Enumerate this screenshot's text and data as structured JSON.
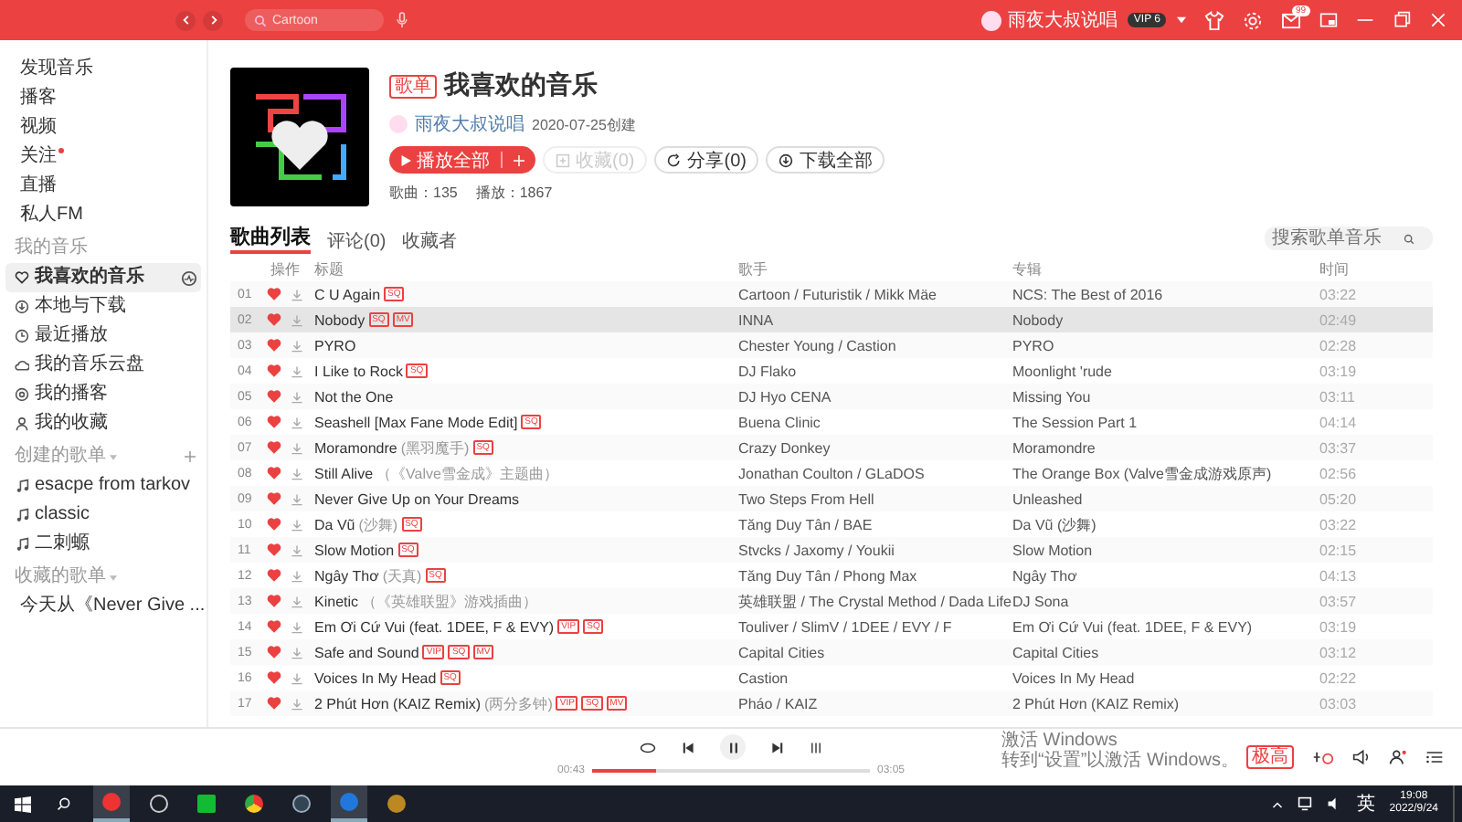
{
  "header": {
    "search": {
      "value": "Cartoon"
    },
    "user": {
      "name": "雨夜大叔说唱",
      "vip": "VIP 6"
    },
    "mail_badge": "99"
  },
  "sidebar": {
    "nav": [
      {
        "label": "发现音乐",
        "dot": false,
        "selected": false
      },
      {
        "label": "播客",
        "dot": false,
        "selected": false
      },
      {
        "label": "视频",
        "dot": false,
        "selected": false
      },
      {
        "label": "关注",
        "dot": true,
        "selected": false
      },
      {
        "label": "直播",
        "dot": false,
        "selected": false
      },
      {
        "label": "私人FM",
        "dot": false,
        "selected": false
      }
    ],
    "my_music": {
      "title": "我的音乐",
      "items": [
        {
          "label": "我喜欢的音乐",
          "selected": true
        },
        {
          "label": "本地与下载",
          "selected": false
        },
        {
          "label": "最近播放",
          "selected": false
        },
        {
          "label": "我的音乐云盘",
          "selected": false
        },
        {
          "label": "我的播客",
          "selected": false
        },
        {
          "label": "我的收藏",
          "selected": false
        }
      ]
    },
    "created": {
      "title": "创建的歌单",
      "items": [
        "esacpe from tarkov",
        "classic",
        "二刺螈"
      ]
    },
    "collected": {
      "title": "收藏的歌单",
      "items": [
        "今天从《Never Give ..."
      ]
    }
  },
  "playlist": {
    "badge": "歌单",
    "title": "我喜欢的音乐",
    "creator": "雨夜大叔说唱",
    "created": "2020-07-25创建",
    "buttons": [
      {
        "kind": "play",
        "label": "播放全部",
        "disabled": false
      },
      {
        "kind": "collect",
        "label": "收藏(0)",
        "disabled": true
      },
      {
        "kind": "share",
        "label": "分享(0)",
        "disabled": false
      },
      {
        "kind": "download",
        "label": "下载全部",
        "disabled": false
      }
    ],
    "stats": [
      "歌曲：135",
      "播放：1867"
    ]
  },
  "tabs": [
    {
      "label": "歌曲列表",
      "selected": true
    },
    {
      "label": "评论(0)",
      "selected": false
    },
    {
      "label": "收藏者",
      "selected": false
    }
  ],
  "list_search": {
    "placeholder": "搜索歌单音乐"
  },
  "columns": [
    "操作",
    "标题",
    "歌手",
    "专辑",
    "时间"
  ],
  "songs": [
    {
      "index": "01",
      "title": "C U Again",
      "tags": [
        "SQ"
      ],
      "singer": "Cartoon / Futuristik / Mikk Mäe",
      "album": "NCS: The Best of 2016",
      "time": "03:22",
      "liked": true,
      "selected": false
    },
    {
      "index": "02",
      "title": "Nobody",
      "tags": [
        "SQ",
        "MV"
      ],
      "singer": "INNA",
      "album": "Nobody",
      "time": "02:49",
      "liked": true,
      "selected": true
    },
    {
      "index": "03",
      "title": "PYRO",
      "singer": "Chester Young / Castion",
      "album": "PYRO",
      "time": "02:28",
      "liked": true,
      "selected": false
    },
    {
      "index": "04",
      "title": "I Like to Rock",
      "tags": [
        "SQ"
      ],
      "singer": "DJ Flako",
      "album": "Moonlight 'rude",
      "time": "03:19",
      "liked": true,
      "selected": false
    },
    {
      "index": "05",
      "title": "Not the One",
      "singer": "DJ Hyo CENA",
      "album": "Missing You",
      "time": "03:11",
      "liked": true,
      "selected": false
    },
    {
      "index": "06",
      "title": "Seashell [Max Fane Mode Edit]",
      "tags": [
        "SQ"
      ],
      "singer": "Buena Clinic",
      "album": "The Session Part 1",
      "time": "04:14",
      "liked": true,
      "selected": false
    },
    {
      "index": "07",
      "title": "Moramondre",
      "sub": "(黑羽魔手)",
      "tags": [
        "SQ"
      ],
      "singer": "Crazy Donkey",
      "album": "Moramondre",
      "time": "03:37",
      "liked": true,
      "selected": false
    },
    {
      "index": "08",
      "title": "Still Alive",
      "sub": "（《Valve雪金成》主题曲）",
      "singer": "Jonathan Coulton / GLaDOS",
      "album": "The Orange Box (Valve雪金成游戏原声)",
      "time": "02:56",
      "liked": true,
      "selected": false
    },
    {
      "index": "09",
      "title": "Never Give Up on Your Dreams",
      "singer": "Two Steps From Hell",
      "album": "Unleashed",
      "time": "05:20",
      "liked": true,
      "selected": false
    },
    {
      "index": "10",
      "title": "Da Vũ",
      "sub": "(沙舞)",
      "tags": [
        "SQ"
      ],
      "singer": "Tăng Duy Tân / BAE",
      "album": "Da Vũ (沙舞)",
      "time": "03:22",
      "liked": true,
      "selected": false
    },
    {
      "index": "11",
      "title": "Slow Motion",
      "tags": [
        "SQ"
      ],
      "singer": "Stvcks / Jaxomy / Youkii",
      "album": "Slow Motion",
      "time": "02:15",
      "liked": true,
      "selected": false
    },
    {
      "index": "12",
      "title": "Ngây Thơ",
      "sub": "(天真)",
      "tags": [
        "SQ"
      ],
      "singer": "Tăng Duy Tân / Phong Max",
      "album": "Ngây Thơ",
      "time": "04:13",
      "liked": true,
      "selected": false
    },
    {
      "index": "13",
      "title": "Kinetic",
      "sub": "（《英雄联盟》游戏插曲）",
      "singer": "英雄联盟 / The Crystal Method / Dada Life",
      "album": "DJ Sona",
      "time": "03:57",
      "liked": true,
      "selected": false
    },
    {
      "index": "14",
      "title": "Em Ơi Cứ Vui (feat. 1DEE, F & EVY)",
      "tags": [
        "VIP",
        "SQ"
      ],
      "singer": "Touliver / SlimV / 1DEE / EVY / F",
      "album": "Em Ơi Cứ Vui (feat. 1DEE, F & EVY)",
      "time": "03:19",
      "liked": true,
      "selected": false
    },
    {
      "index": "15",
      "title": "Safe and Sound",
      "tags": [
        "VIP",
        "SQ",
        "MV"
      ],
      "singer": "Capital Cities",
      "album": "Capital Cities",
      "time": "03:12",
      "liked": true,
      "selected": false
    },
    {
      "index": "16",
      "title": "Voices In My Head",
      "tags": [
        "SQ"
      ],
      "singer": "Castion",
      "album": "Voices In My Head",
      "time": "02:22",
      "liked": true,
      "selected": false
    },
    {
      "index": "17",
      "title": "2 Phút Hơn (KAIZ Remix)",
      "sub": "(两分多钟)",
      "tags": [
        "VIP",
        "SQ",
        "MV"
      ],
      "singer": "Pháo / KAIZ",
      "album": "2 Phút Hơn (KAIZ Remix)",
      "time": "03:03",
      "liked": true,
      "selected": false
    }
  ],
  "activation_notice": {
    "title": "激活 Windows",
    "hint": "转到“设置”以激活 Windows。"
  },
  "player": {
    "elapsed": "00:43",
    "total": "03:05",
    "level": 0.23,
    "playing": true,
    "quality": "极高"
  },
  "taskbar": {
    "ime": "英",
    "time": "19:08",
    "date": "2022/9/24"
  }
}
